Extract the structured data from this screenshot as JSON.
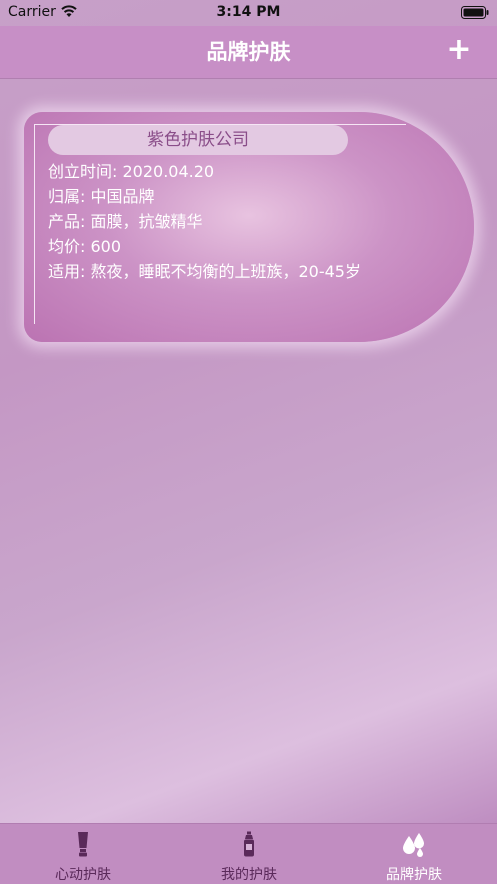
{
  "status_bar": {
    "carrier": "Carrier",
    "time": "3:14 PM"
  },
  "nav": {
    "title": "品牌护肤",
    "add_label": "+"
  },
  "brand_card": {
    "name": "紫色护肤公司",
    "lines": [
      "创立时间: 2020.04.20",
      "归属: 中国品牌",
      "产品: 面膜，抗皱精华",
      "均价: 600",
      "适用: 熬夜，睡眠不均衡的上班族，20-45岁"
    ]
  },
  "tabs": [
    {
      "label": "心动护肤",
      "icon": "tube-icon",
      "active": false
    },
    {
      "label": "我的护肤",
      "icon": "bottle-icon",
      "active": false
    },
    {
      "label": "品牌护肤",
      "icon": "drops-icon",
      "active": true
    }
  ],
  "colors": {
    "nav_bg": "#c78fc6",
    "card_name_text": "#8a4d89",
    "tab_inactive": "#5a2a5a",
    "tab_active": "#ffffff"
  }
}
